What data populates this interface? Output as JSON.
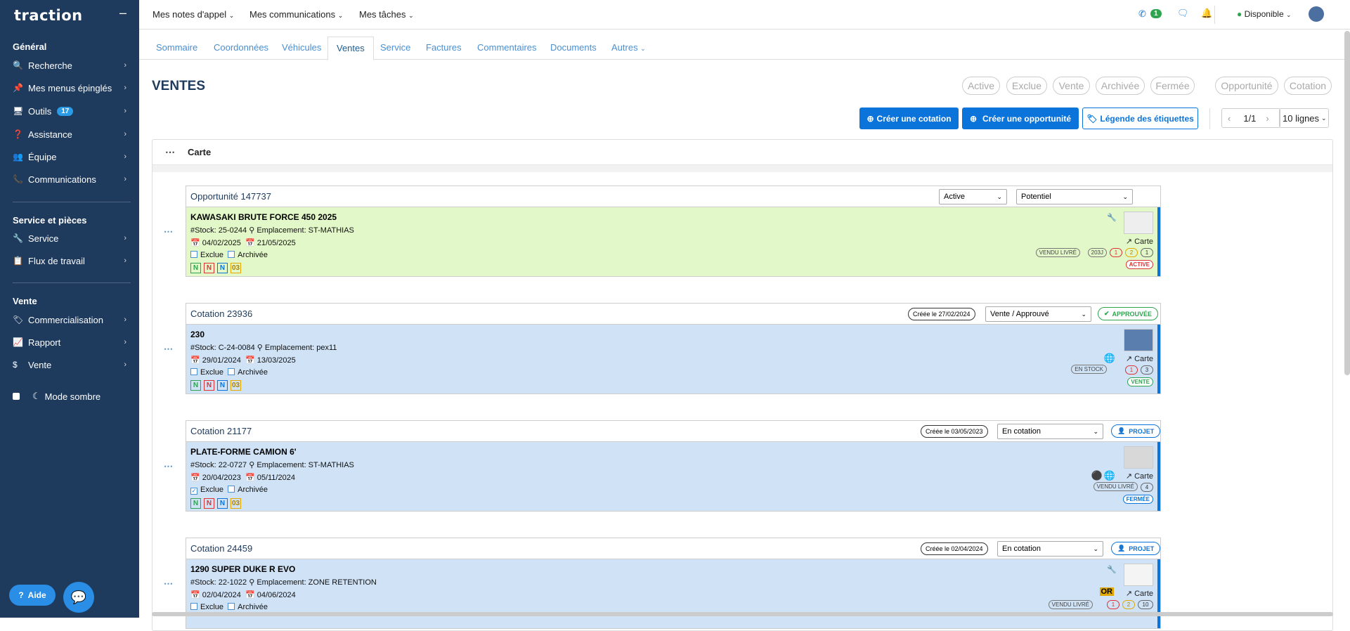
{
  "app": {
    "logo": "traction",
    "collapse_icon": "minus-icon"
  },
  "sidebar": {
    "sections": [
      {
        "title": "Général"
      },
      {
        "title": "Service et pièces"
      },
      {
        "title": "Vente"
      }
    ],
    "items": [
      {
        "label": "Recherche",
        "icon": "search-icon"
      },
      {
        "label": "Mes menus épinglés",
        "icon": "pin-icon"
      },
      {
        "label": "Outils",
        "icon": "monitor-icon",
        "badge": "17"
      },
      {
        "label": "Assistance",
        "icon": "help-icon"
      },
      {
        "label": "Équipe",
        "icon": "team-icon"
      },
      {
        "label": "Communications",
        "icon": "phone-icon"
      },
      {
        "label": "Service",
        "icon": "wrench-icon"
      },
      {
        "label": "Flux de travail",
        "icon": "clipboard-icon"
      },
      {
        "label": "Commercialisation",
        "icon": "tag-icon"
      },
      {
        "label": "Rapport",
        "icon": "chart-icon"
      },
      {
        "label": "Vente",
        "icon": "dollar-icon"
      }
    ],
    "dark_mode": "Mode sombre",
    "help_button": "Aide"
  },
  "topbar": {
    "menus": [
      "Mes notes d'appel",
      "Mes communications",
      "Mes tâches"
    ],
    "phone_badge": "1",
    "status": "Disponible"
  },
  "tabs": [
    "Sommaire",
    "Coordonnées",
    "Véhicules",
    "Ventes",
    "Service",
    "Factures",
    "Commentaires",
    "Documents",
    "Autres"
  ],
  "page": {
    "title": "VENTES",
    "filters": [
      "Active",
      "Exclue",
      "Vente",
      "Archivée",
      "Fermée"
    ],
    "filters2": [
      "Opportunité",
      "Cotation"
    ],
    "buttons": {
      "create_quote": "Créer une cotation",
      "create_opportunity": "Créer une opportunité",
      "legend": "Légende des étiquettes"
    },
    "pager": {
      "page": "1/1",
      "rows": "10 lignes"
    },
    "panel_title": "Carte"
  },
  "cards": [
    {
      "header": "Opportunité 147737",
      "select1": "Active",
      "select2": "Potentiel",
      "title": "KAWASAKI BRUTE FORCE 450 2025",
      "stock": "#Stock: 25-0244",
      "location": "Emplacement: ST-MATHIAS",
      "date1": "04/02/2025",
      "date2": "21/05/2025",
      "exclue": "Exclue",
      "archivee": "Archivée",
      "tags": [
        "N",
        "N",
        "N",
        "03"
      ],
      "carte": "Carte",
      "right_tags": [
        "VENDU LIVRÉ",
        "203J"
      ],
      "counts": [
        "1",
        "2",
        "1"
      ],
      "status": "ACTIVE"
    },
    {
      "header": "Cotation 23936",
      "created": "Créée le 27/02/2024",
      "select1": "Vente / Approuvé",
      "badge": "APPROUVÉE",
      "title": "230",
      "stock": "#Stock: C-24-0084",
      "location": "Emplacement: pex11",
      "date1": "29/01/2024",
      "date2": "13/03/2025",
      "exclue": "Exclue",
      "archivee": "Archivée",
      "tags": [
        "N",
        "N",
        "N",
        "03"
      ],
      "carte": "Carte",
      "right_tags": [
        "EN STOCK"
      ],
      "counts": [
        "1",
        "3"
      ],
      "status": "VENTE"
    },
    {
      "header": "Cotation 21177",
      "created": "Créée le 03/05/2023",
      "select1": "En cotation",
      "badge": "PROJET",
      "title": "PLATE-FORME CAMION 6'",
      "stock": "#Stock: 22-0727",
      "location": "Emplacement: ST-MATHIAS",
      "date1": "20/04/2023",
      "date2": "05/11/2024",
      "exclue": "Exclue",
      "archivee": "Archivée",
      "tags": [
        "N",
        "N",
        "N",
        "03"
      ],
      "carte": "Carte",
      "right_tags": [
        "VENDU LIVRÉ"
      ],
      "counts": [
        "4"
      ],
      "status": "FERMÉE"
    },
    {
      "header": "Cotation 24459",
      "created": "Créée le 02/04/2024",
      "select1": "En cotation",
      "badge": "PROJET",
      "title": "1290 SUPER DUKE R EVO",
      "stock": "#Stock: 22-1022",
      "location": "Emplacement: ZONE RETENTION",
      "date1": "02/04/2024",
      "date2": "04/06/2024",
      "exclue": "Exclue",
      "archivee": "Archivée",
      "carte": "Carte",
      "or_badge": "OR",
      "right_tags": [
        "VENDU LIVRÉ"
      ],
      "counts": [
        "1",
        "2",
        "10"
      ]
    }
  ]
}
